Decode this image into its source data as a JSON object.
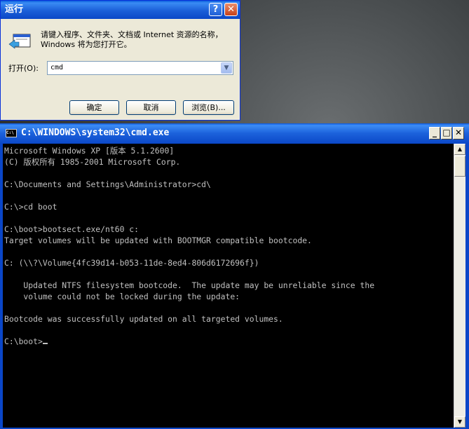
{
  "run_dialog": {
    "title": "运行",
    "help_label": "?",
    "close_label": "✕",
    "description": "请键入程序、文件夹、文档或 Internet 资源的名称，Windows 将为您打开它。",
    "open_label": "打开(O):",
    "open_value": "cmd",
    "dropdown_glyph": "▼",
    "ok_label": "确定",
    "cancel_label": "取消",
    "browse_label": "浏览(B)..."
  },
  "cmd_window": {
    "title": "C:\\WINDOWS\\system32\\cmd.exe",
    "icon_text": "C:\\",
    "min_label": "_",
    "max_label": "□",
    "close_label": "✕",
    "lines": [
      "Microsoft Windows XP [版本 5.1.2600]",
      "(C) 版权所有 1985-2001 Microsoft Corp.",
      "",
      "C:\\Documents and Settings\\Administrator>cd\\",
      "",
      "C:\\>cd boot",
      "",
      "C:\\boot>bootsect.exe/nt60 c:",
      "Target volumes will be updated with BOOTMGR compatible bootcode.",
      "",
      "C: (\\\\?\\Volume{4fc39d14-b053-11de-8ed4-806d6172696f})",
      "",
      "    Updated NTFS filesystem bootcode.  The update may be unreliable since the",
      "    volume could not be locked during the update:",
      "",
      "Bootcode was successfully updated on all targeted volumes.",
      "",
      "C:\\boot>"
    ],
    "scroll_up": "▲",
    "scroll_down": "▼"
  }
}
